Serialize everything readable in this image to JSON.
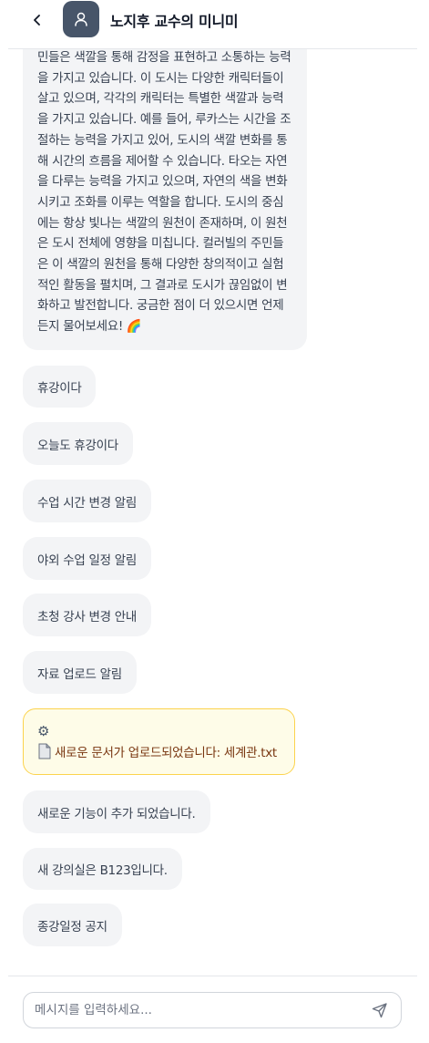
{
  "header": {
    "title": "노지후 교수의 미니미"
  },
  "messages": {
    "long_reply": "민들은 색깔을 통해 감정을 표현하고 소통하는 능력을 가지고 있습니다. 이 도시는 다양한 캐릭터들이 살고 있으며, 각각의 캐릭터는 특별한 색깔과 능력을 가지고 있습니다. 예를 들어, 루카스는 시간을 조절하는 능력을 가지고 있어, 도시의 색깔 변화를 통해 시간의 흐름을 제어할 수 있습니다. 타오는 자연을 다루는 능력을 가지고 있으며, 자연의 색을 변화시키고 조화를 이루는 역할을 합니다. 도시의 중심에는 항상 빛나는 색깔의 원천이 존재하며, 이 원천은 도시 전체에 영향을 미칩니다. 컬러빌의 주민들은 이 색깔의 원천을 통해 다양한 창의적이고 실험적인 활동을 펼치며, 그 결과로 도시가 끊임없이 변화하고 발전합니다. 궁금한 점이 더 있으시면 언제든지 물어보세요! 🌈",
    "items": [
      "휴강이다",
      "오늘도 휴강이다",
      "수업 시간 변경 알림",
      "야외 수업 일정 알림",
      "초청 강사 변경 안내",
      "자료 업로드 알림"
    ],
    "notice": {
      "gear_icon": "gear-icon",
      "doc_icon": "document-icon",
      "text": "새로운 문서가 업로드되었습니다: 세계관.txt"
    },
    "items_after": [
      "새로운 기능이 추가 되었습니다.",
      "새 강의실은 B123입니다.",
      "종강일정 공지"
    ]
  },
  "input": {
    "placeholder": "메시지를 입력하세요..."
  },
  "colors": {
    "avatar_bg": "#475569",
    "bubble_bg": "#f3f4f6",
    "notice_bg": "#fefce8",
    "notice_border": "#fcd34d",
    "notice_text": "#78350f"
  }
}
